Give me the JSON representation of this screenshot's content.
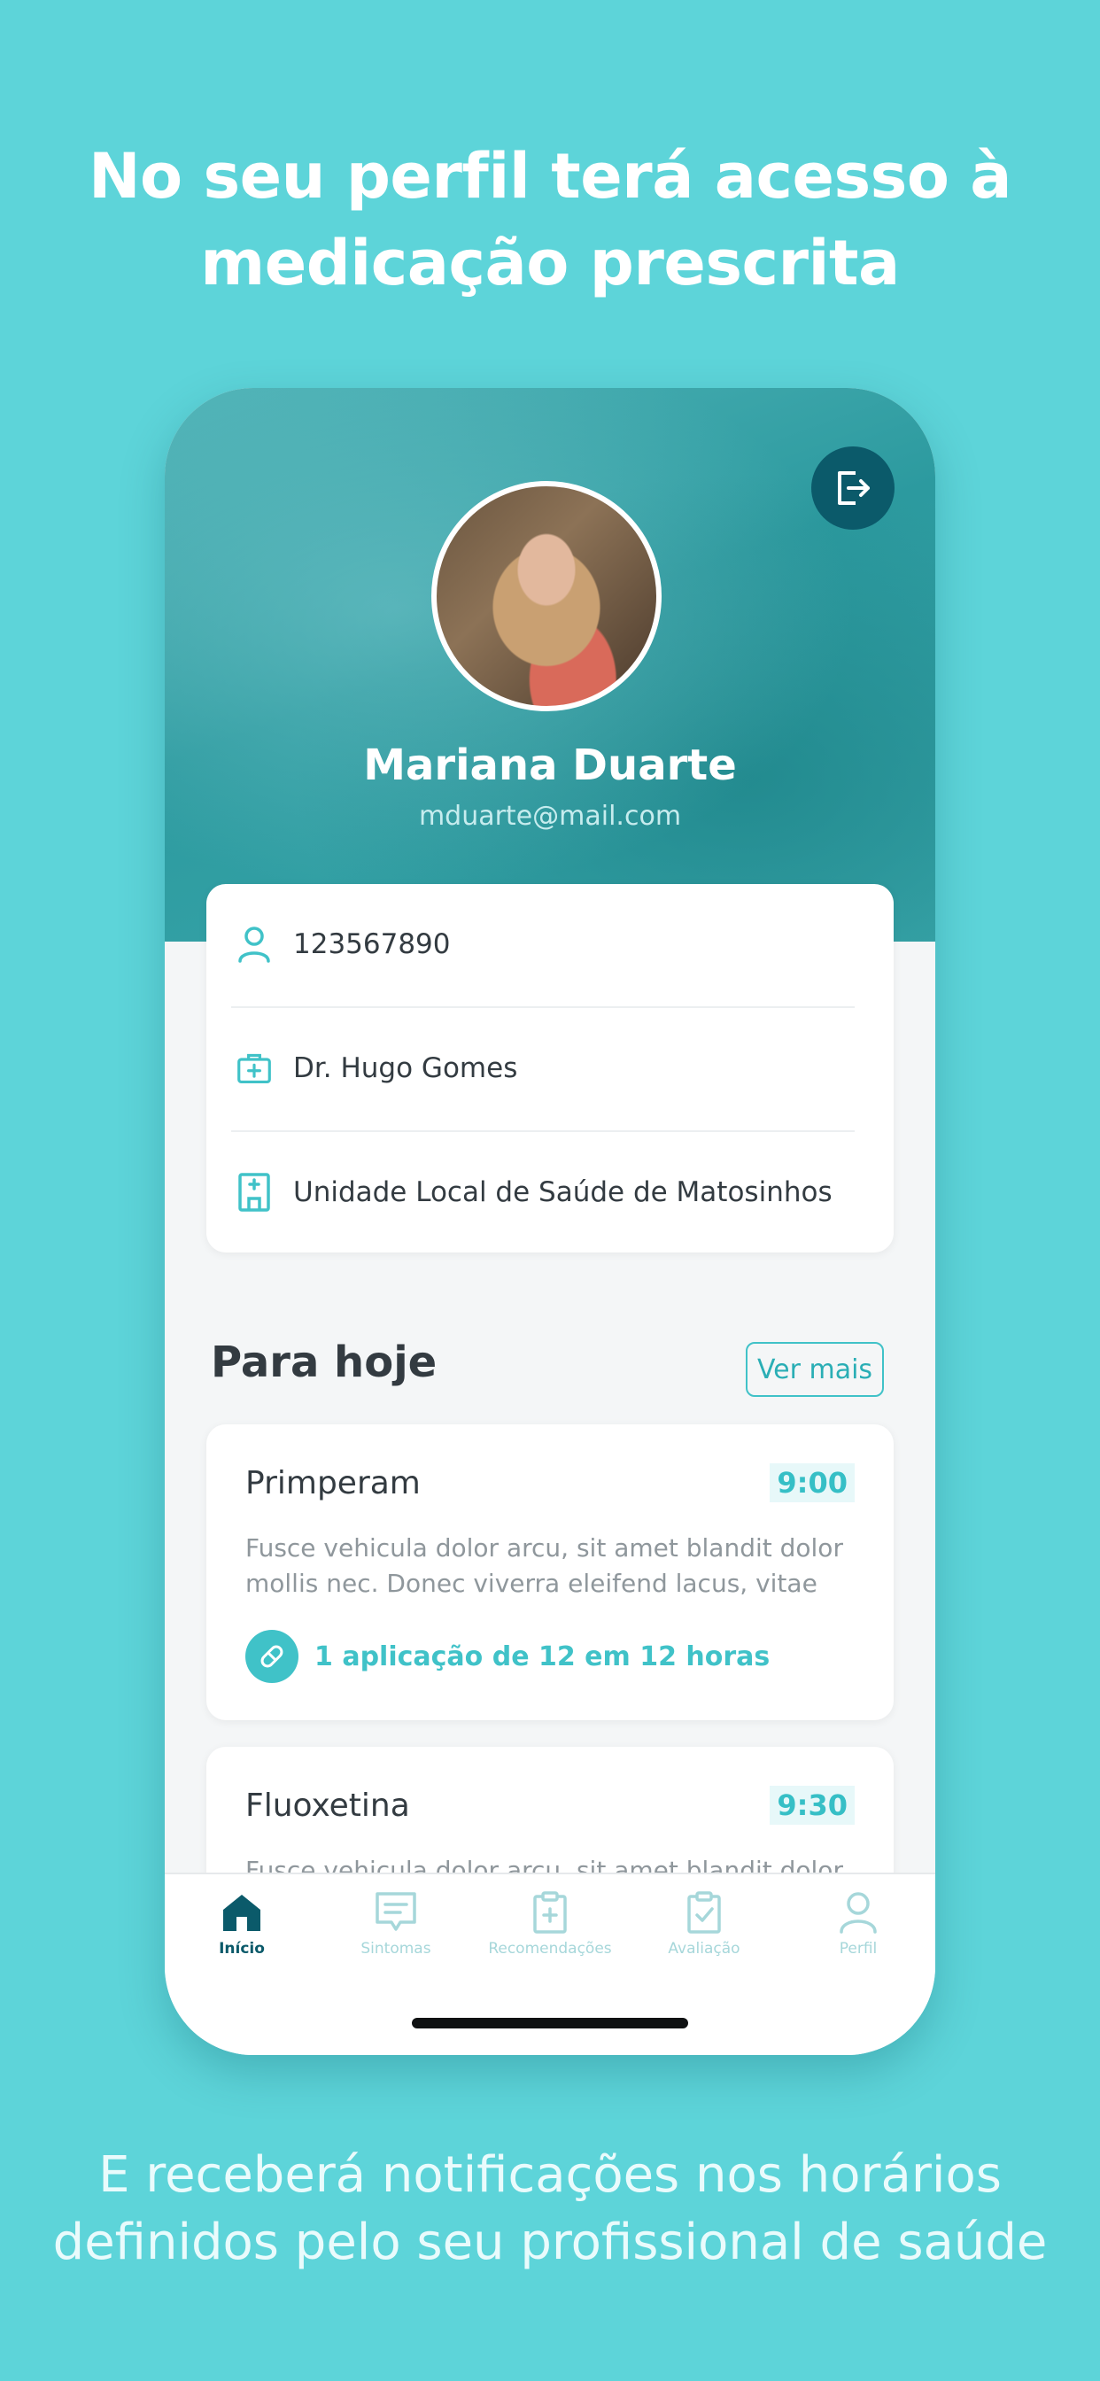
{
  "headline": [
    "No seu perfil terá acesso à",
    "medicação prescrita"
  ],
  "footer": [
    "E receberá notificações nos horários",
    "definidos pelo seu profissional de saúde"
  ],
  "profile": {
    "name": "Mariana Duarte",
    "email": "mduarte@mail.com",
    "number": "123567890",
    "doctor": "Dr. Hugo Gomes",
    "unit": "Unidade Local de Saúde de Matosinhos"
  },
  "today": {
    "title": "Para hoje",
    "see_more": "Ver mais",
    "items": [
      {
        "name": "Primperam",
        "time": "9:00",
        "desc": [
          "Fusce vehicula dolor arcu, sit amet blandit dolor",
          "mollis nec. Donec viverra eleifend lacus, vitae"
        ],
        "dose": "1 aplicação de 12 em 12 horas"
      },
      {
        "name": "Fluoxetina",
        "time": "9:30",
        "desc": [
          "Fusce vehicula dolor arcu, sit amet blandit dolor"
        ]
      }
    ]
  },
  "tabs": [
    {
      "label": "Início",
      "icon": "home-icon",
      "active": true
    },
    {
      "label": "Sintomas",
      "icon": "chat-icon",
      "active": false
    },
    {
      "label": "Recomendações",
      "icon": "clipboard-plus-icon",
      "active": false
    },
    {
      "label": "Avaliação",
      "icon": "clipboard-check-icon",
      "active": false
    },
    {
      "label": "Perfil",
      "icon": "user-icon",
      "active": false
    }
  ],
  "colors": {
    "background": "#5dd4d9",
    "accent": "#40c2c8",
    "dark_accent": "#0b5a6a"
  }
}
